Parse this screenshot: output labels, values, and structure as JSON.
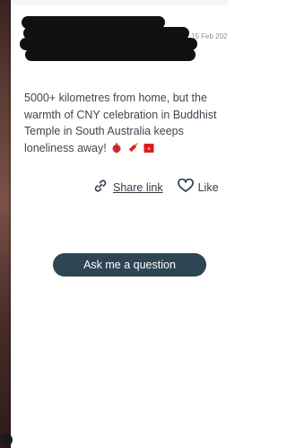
{
  "post": {
    "date": "15 Feb 202",
    "text": "5000+ kilometres from home, but the warmth of CNY celebration in Buddhist Temple in South Australia keeps loneliness away!"
  },
  "actions": {
    "share_label": "Share link",
    "like_label": "Like"
  },
  "cta": {
    "ask_label": "Ask me a question"
  },
  "colors": {
    "button_bg": "#2f4554",
    "text": "#3d4650",
    "muted": "#8a8f96"
  },
  "icons": [
    "red-lantern-icon",
    "firecracker-icon",
    "red-envelope-icon",
    "link-icon",
    "heart-icon"
  ]
}
